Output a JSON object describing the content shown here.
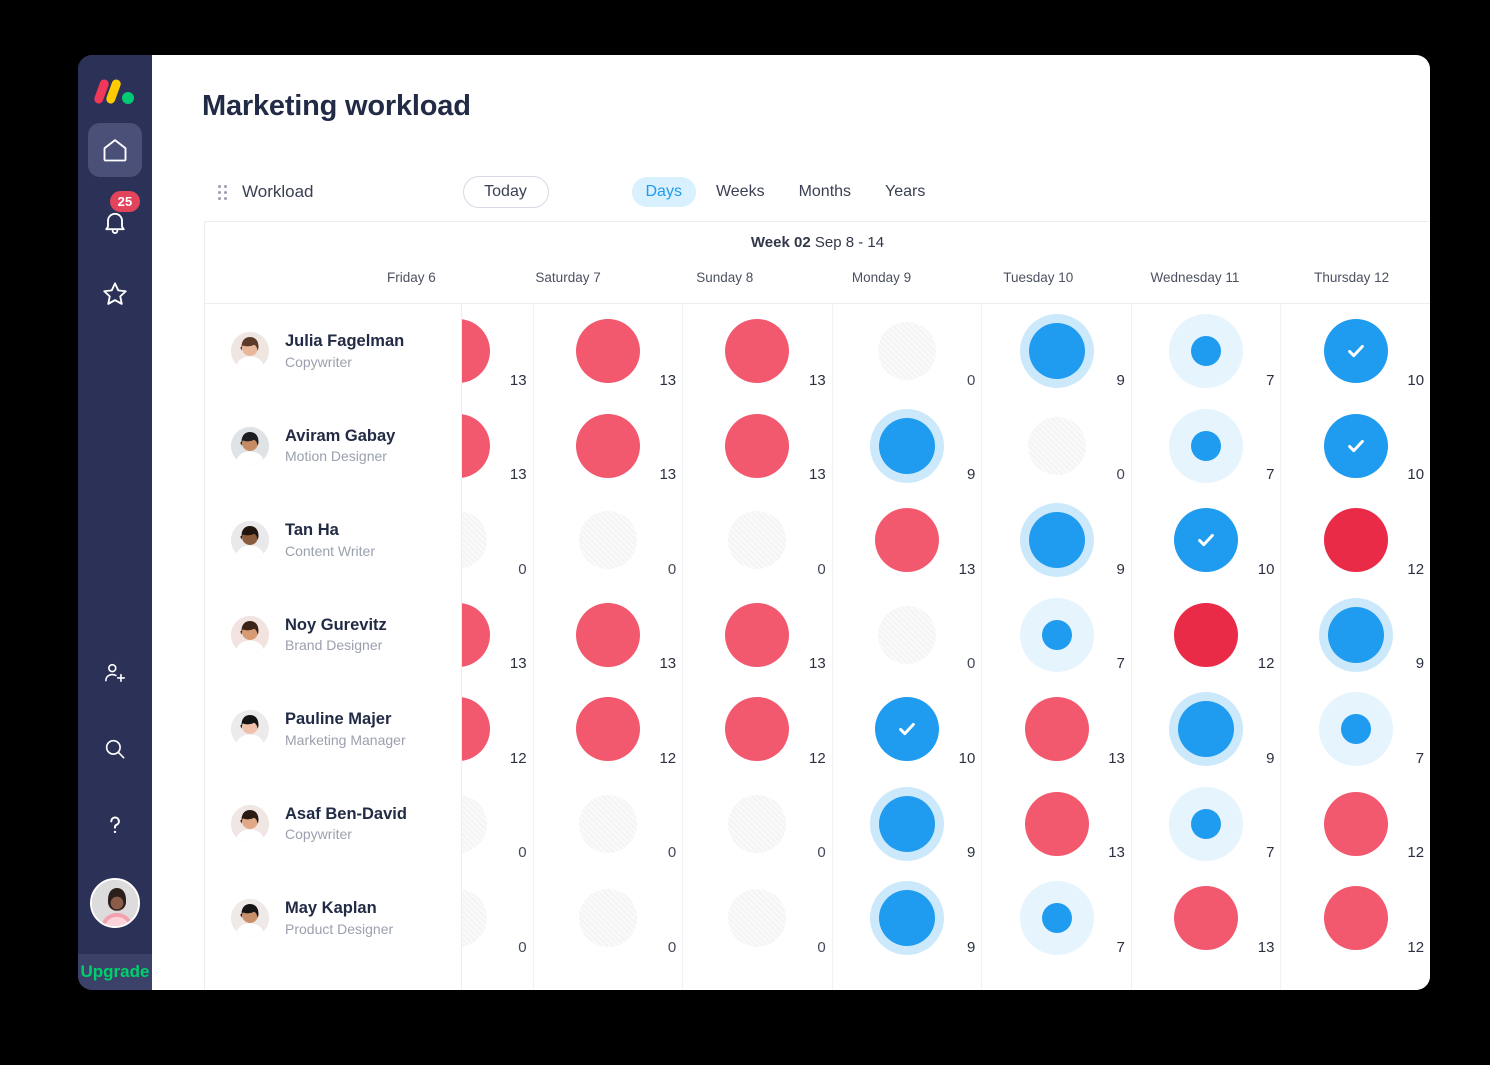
{
  "window": {
    "title": "Marketing workload"
  },
  "sidebar": {
    "logo_name": "monday-logo",
    "items": [
      {
        "name": "home",
        "label": "Home",
        "icon": "home-icon",
        "active": true
      },
      {
        "name": "notifications",
        "label": "Notifications",
        "icon": "bell-icon",
        "badge": "25"
      },
      {
        "name": "favorites",
        "label": "Favorites",
        "icon": "star-icon"
      }
    ],
    "bottom_items": [
      {
        "name": "invite",
        "label": "Invite members",
        "icon": "add-user-icon"
      },
      {
        "name": "search",
        "label": "Search",
        "icon": "search-icon"
      },
      {
        "name": "help",
        "label": "Help",
        "icon": "question-mark-icon"
      }
    ],
    "account_avatar_label": "Account avatar",
    "upgrade_label": "Upgrade",
    "colors": {
      "rail_bg": "#2b3157",
      "upgrade_text": "#00d06c",
      "badge_bg": "#e2445c"
    }
  },
  "toolbar": {
    "drag_handle": "drag-handle",
    "view_name": "Workload",
    "today_label": "Today",
    "zoom_levels": [
      {
        "label": "Days",
        "active": true
      },
      {
        "label": "Weeks",
        "active": false
      },
      {
        "label": "Months",
        "active": false
      },
      {
        "label": "Years",
        "active": false
      }
    ]
  },
  "board": {
    "week_prefix": "Week 02",
    "week_range": "Sep 8 - 14",
    "day_columns": [
      "Friday 6",
      "Saturday 7",
      "Sunday 8",
      "Monday 9",
      "Tuesday 10",
      "Wednesday 11",
      "Thursday 12"
    ],
    "colors": {
      "blue": "#1f9bf0",
      "blue_ring": "#cce9fb",
      "blue_ring_light": "#e6f4fd",
      "pink": "#f2596f",
      "red": "#ea2b48",
      "empty": "#f4f4f6"
    },
    "people": [
      {
        "name": "Julia Fagelman",
        "role": "Copywriter",
        "avatar_label": "Julia Fagelman avatar",
        "cells": [
          {
            "value": "13",
            "state": "over-pink"
          },
          {
            "value": "13",
            "state": "over-pink"
          },
          {
            "value": "13",
            "state": "over-pink"
          },
          {
            "value": "0",
            "state": "empty"
          },
          {
            "value": "9",
            "state": "partial-high"
          },
          {
            "value": "7",
            "state": "partial-low"
          },
          {
            "value": "10",
            "state": "full-check"
          }
        ]
      },
      {
        "name": "Aviram Gabay",
        "role": "Motion Designer",
        "avatar_label": "Aviram Gabay avatar",
        "cells": [
          {
            "value": "13",
            "state": "over-pink"
          },
          {
            "value": "13",
            "state": "over-pink"
          },
          {
            "value": "13",
            "state": "over-pink"
          },
          {
            "value": "9",
            "state": "partial-high"
          },
          {
            "value": "0",
            "state": "empty"
          },
          {
            "value": "7",
            "state": "partial-low"
          },
          {
            "value": "10",
            "state": "full-check"
          }
        ]
      },
      {
        "name": "Tan Ha",
        "role": "Content Writer",
        "avatar_label": "Tan Ha avatar",
        "cells": [
          {
            "value": "0",
            "state": "empty"
          },
          {
            "value": "0",
            "state": "empty"
          },
          {
            "value": "0",
            "state": "empty"
          },
          {
            "value": "13",
            "state": "over-pink"
          },
          {
            "value": "9",
            "state": "partial-high"
          },
          {
            "value": "10",
            "state": "full-check"
          },
          {
            "value": "12",
            "state": "over-red"
          }
        ]
      },
      {
        "name": "Noy Gurevitz",
        "role": "Brand Designer",
        "avatar_label": "Noy Gurevitz avatar",
        "cells": [
          {
            "value": "13",
            "state": "over-pink"
          },
          {
            "value": "13",
            "state": "over-pink"
          },
          {
            "value": "13",
            "state": "over-pink"
          },
          {
            "value": "0",
            "state": "empty"
          },
          {
            "value": "7",
            "state": "partial-low"
          },
          {
            "value": "12",
            "state": "over-red"
          },
          {
            "value": "9",
            "state": "partial-high"
          }
        ]
      },
      {
        "name": "Pauline Majer",
        "role": "Marketing Manager",
        "avatar_label": "Pauline Majer avatar",
        "cells": [
          {
            "value": "12",
            "state": "over-pink"
          },
          {
            "value": "12",
            "state": "over-pink"
          },
          {
            "value": "12",
            "state": "over-pink"
          },
          {
            "value": "10",
            "state": "full-check"
          },
          {
            "value": "13",
            "state": "over-pink"
          },
          {
            "value": "9",
            "state": "partial-high"
          },
          {
            "value": "7",
            "state": "partial-low"
          }
        ]
      },
      {
        "name": "Asaf Ben-David",
        "role": "Copywriter",
        "avatar_label": "Asaf Ben-David avatar",
        "cells": [
          {
            "value": "0",
            "state": "empty"
          },
          {
            "value": "0",
            "state": "empty"
          },
          {
            "value": "0",
            "state": "empty"
          },
          {
            "value": "9",
            "state": "partial-high"
          },
          {
            "value": "13",
            "state": "over-pink"
          },
          {
            "value": "7",
            "state": "partial-low"
          },
          {
            "value": "12",
            "state": "over-pink"
          }
        ]
      },
      {
        "name": "May Kaplan",
        "role": "Product Designer",
        "avatar_label": "May Kaplan avatar",
        "cells": [
          {
            "value": "0",
            "state": "empty"
          },
          {
            "value": "0",
            "state": "empty"
          },
          {
            "value": "0",
            "state": "empty"
          },
          {
            "value": "9",
            "state": "partial-high"
          },
          {
            "value": "7",
            "state": "partial-low"
          },
          {
            "value": "13",
            "state": "over-pink"
          },
          {
            "value": "12",
            "state": "over-pink"
          }
        ]
      }
    ]
  }
}
